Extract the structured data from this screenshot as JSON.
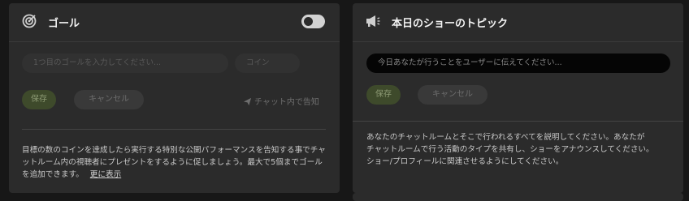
{
  "goal_panel": {
    "title": "ゴール",
    "toggle_on": false,
    "goal_input_placeholder": "1つ目のゴールを入力してください...",
    "coin_input_placeholder": "コイン",
    "save_label": "保存",
    "cancel_label": "キャンセル",
    "notify_label": "チャット内で告知",
    "description": "目標の数のコインを達成したら実行する特別な公開パフォーマンスを告知する事でチャットルーム内の視聴者にプレゼントをするように促しましょう。最大で5個までゴールを追加できます。",
    "more_link": "更に表示"
  },
  "topic_panel": {
    "title": "本日のショーのトピック",
    "topic_input_placeholder": "今日あなたが行うことをユーザーに伝えてください...",
    "save_label": "保存",
    "cancel_label": "キャンセル",
    "description_lines": [
      "あなたのチャットルームとそこで行われるすべてを説明してください。あなたが",
      "チャットルームで行う活動のタイプを共有し、ショーをアナウンスしてください。",
      "ショー/プロフィールに関連させるようにしてください。"
    ]
  },
  "icons": {
    "goal": "target-icon",
    "topic": "megaphone-icon",
    "notify": "paper-plane-icon"
  },
  "colors": {
    "panel_bg": "#2b2b2b",
    "page_bg": "#171717",
    "save_bg": "#3e4a2b"
  }
}
